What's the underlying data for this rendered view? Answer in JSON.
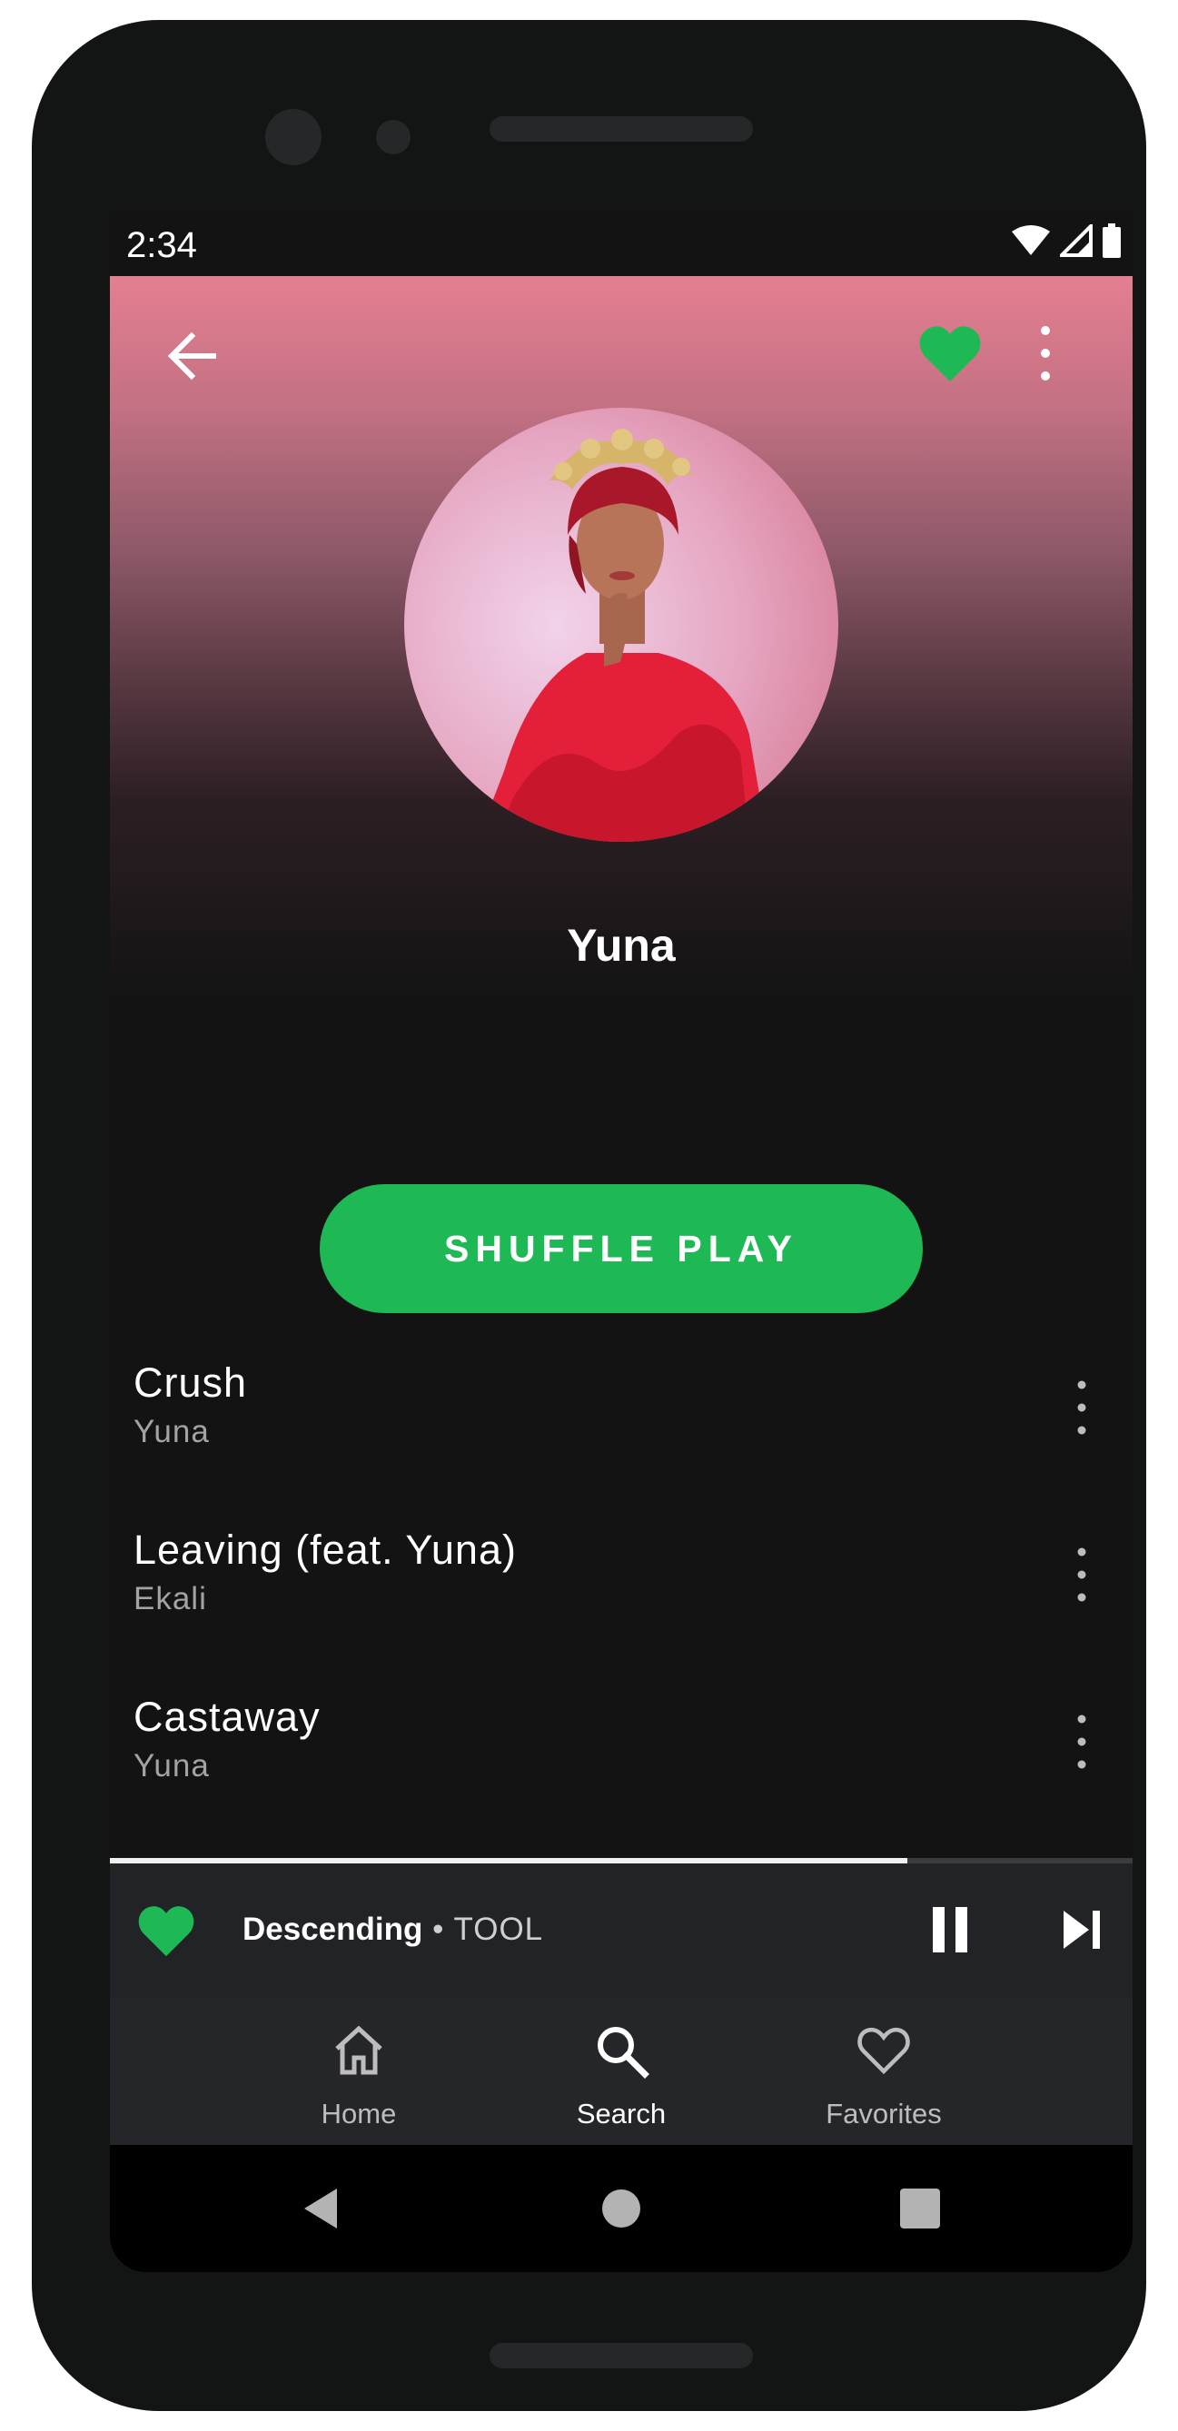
{
  "status_bar": {
    "time": "2:34"
  },
  "artist": {
    "name": "Yuna"
  },
  "shuffle": {
    "label": "SHUFFLE PLAY"
  },
  "tracks": [
    {
      "title": "Crush",
      "artist": "Yuna"
    },
    {
      "title": "Leaving (feat. Yuna)",
      "artist": "Ekali"
    },
    {
      "title": "Castaway",
      "artist": "Yuna"
    }
  ],
  "now_playing": {
    "title": "Descending",
    "separator": " • ",
    "artist": "TOOL",
    "progress": 0.78
  },
  "bottom_nav": [
    {
      "label": "Home",
      "icon": "home-icon",
      "active": false
    },
    {
      "label": "Search",
      "icon": "search-icon",
      "active": true
    },
    {
      "label": "Favorites",
      "icon": "heart-outline-icon",
      "active": false
    }
  ],
  "colors": {
    "accent": "#1eb854",
    "header_top": "#e47f91",
    "background": "#131313",
    "nav_bg": "#25262a",
    "player_bg": "#222326"
  }
}
